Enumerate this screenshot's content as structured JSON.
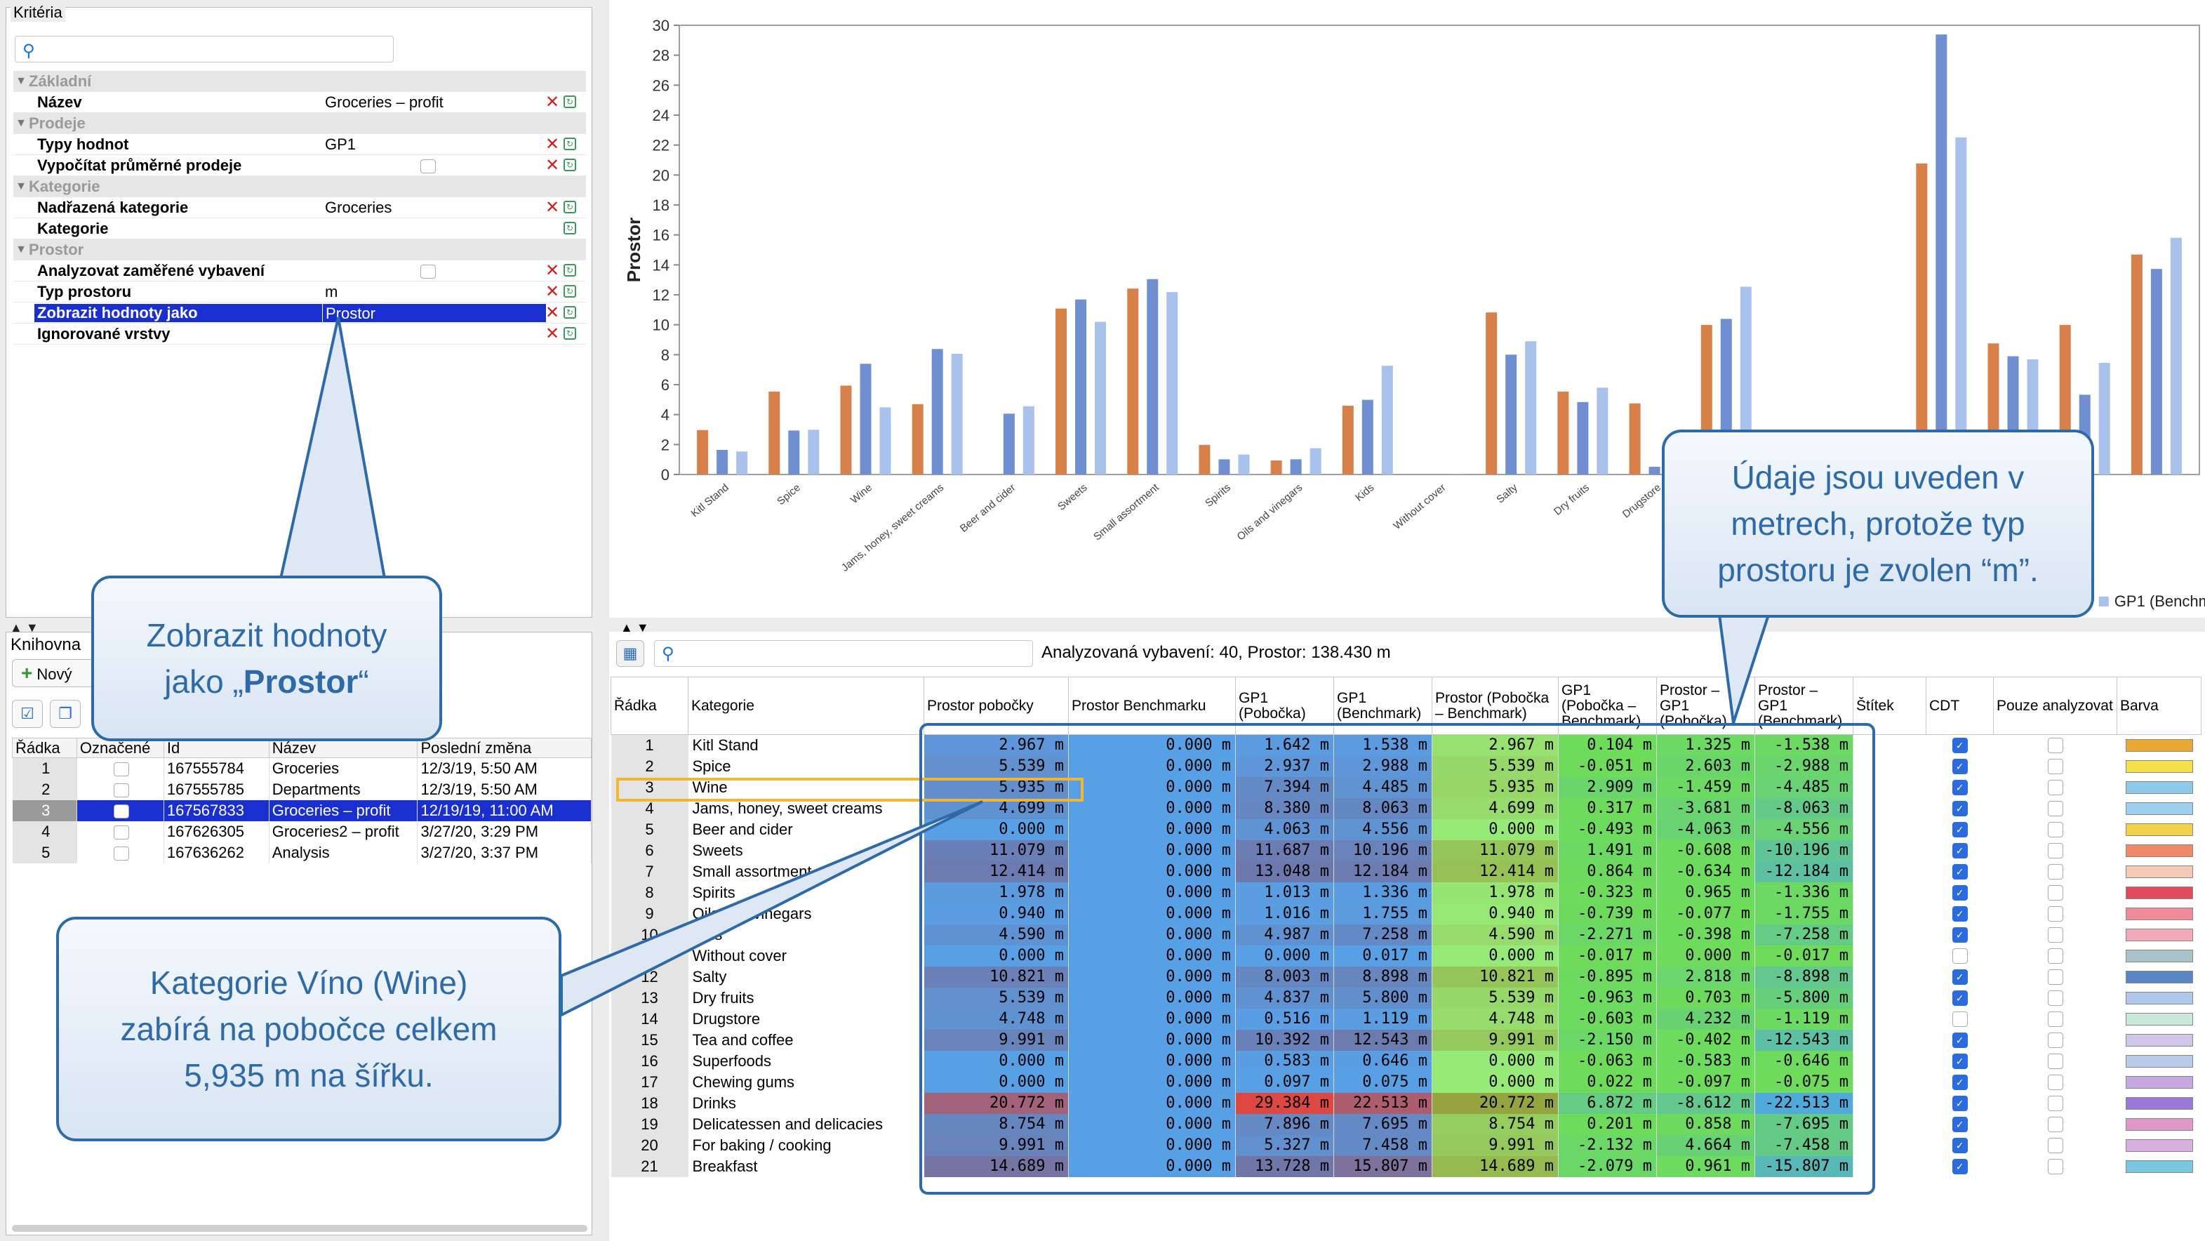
{
  "criteria": {
    "title": "Kritéria",
    "groups": [
      {
        "label": "Základní",
        "rows": [
          {
            "label": "Název",
            "value": "Groceries – profit",
            "check": false
          }
        ]
      },
      {
        "label": "Prodeje",
        "rows": [
          {
            "label": "Typy hodnot",
            "value": "GP1",
            "check": false
          },
          {
            "label": "Vypočítat průměrné prodeje",
            "value": "",
            "check": true
          }
        ]
      },
      {
        "label": "Kategorie",
        "rows": [
          {
            "label": "Nadřazená kategorie",
            "value": "Groceries",
            "check": false
          },
          {
            "label": "Kategorie",
            "value": "",
            "check": false
          }
        ]
      },
      {
        "label": "Prostor",
        "rows": [
          {
            "label": "Analyzovat zaměřené vybavení",
            "value": "",
            "check": true
          },
          {
            "label": "Typ prostoru",
            "value": "m",
            "check": false
          },
          {
            "label": "Zobrazit hodnoty jako",
            "value": "Prostor",
            "check": false,
            "selected": true
          },
          {
            "label": "Ignorované vrstvy",
            "value": "",
            "check": false
          }
        ]
      }
    ]
  },
  "library": {
    "title": "Knihovna",
    "new_label": "Nový",
    "columns": [
      "Řádka",
      "Označené",
      "Id",
      "Název",
      "Poslední změna"
    ],
    "rows": [
      {
        "n": "1",
        "id": "167555784",
        "name": "Groceries",
        "changed": "12/3/19, 5:50 AM"
      },
      {
        "n": "2",
        "id": "167555785",
        "name": "Departments",
        "changed": "12/3/19, 5:50 AM"
      },
      {
        "n": "3",
        "id": "167567833",
        "name": "Groceries – profit",
        "changed": "12/19/19, 11:00 AM",
        "selected": true
      },
      {
        "n": "4",
        "id": "167626305",
        "name": "Groceries2 – profit",
        "changed": "3/27/20, 3:29 PM"
      },
      {
        "n": "5",
        "id": "167636262",
        "name": "Analysis",
        "changed": "3/27/20, 3:37 PM"
      }
    ]
  },
  "chart_data": {
    "type": "bar",
    "ylabel": "Prostor",
    "ylim": [
      0,
      30
    ],
    "yticks": [
      0,
      2,
      4,
      6,
      8,
      10,
      12,
      14,
      16,
      18,
      20,
      22,
      24,
      26,
      28,
      30
    ],
    "grid": false,
    "legend": "bottom",
    "categories": [
      "Kitl Stand",
      "Spice",
      "Wine",
      "Jams, honey, sweet creams",
      "Beer and cider",
      "Sweets",
      "Small assortment",
      "Spirits",
      "Oils and vinegars",
      "Kids",
      "Without cover",
      "Salty",
      "Dry fruits",
      "Drugstore",
      "Tea and coffee",
      "Superfoods",
      "Chewing gums",
      "Drinks",
      "Delicatessen and delicacies",
      "For baking / cooking",
      "Breakfast"
    ],
    "visible_tick_count": 15,
    "series": [
      {
        "name": "Prostor pobočky",
        "color": "#d8804a",
        "values": [
          2.967,
          5.539,
          5.935,
          4.699,
          0.0,
          11.079,
          12.414,
          1.978,
          0.94,
          4.59,
          0.0,
          10.821,
          5.539,
          4.748,
          9.991,
          0.0,
          0.0,
          20.772,
          8.754,
          9.991,
          14.689
        ]
      },
      {
        "name": "GP1 (Pobočka)",
        "color": "#6f8fd0",
        "values": [
          1.642,
          2.937,
          7.394,
          8.38,
          4.063,
          11.687,
          13.048,
          1.013,
          1.016,
          4.987,
          0.0,
          8.003,
          4.837,
          0.516,
          10.392,
          0.583,
          0.097,
          29.384,
          7.896,
          5.327,
          13.728
        ]
      },
      {
        "name": "GP1 (Benchmark)",
        "color": "#a9c2ec",
        "values": [
          1.538,
          2.988,
          4.485,
          8.063,
          4.556,
          10.196,
          12.184,
          1.336,
          1.755,
          7.258,
          0.017,
          8.898,
          5.8,
          1.119,
          12.543,
          0.646,
          0.075,
          22.513,
          7.695,
          7.458,
          15.807
        ]
      }
    ]
  },
  "data_table": {
    "summary": "Analyzovaná vybavení: 40, Prostor: 138.430 m",
    "columns": [
      "Řádka",
      "Kategorie",
      "Prostor pobočky",
      "Prostor Benchmarku",
      "GP1 (Pobočka)",
      "GP1 (Benchmark)",
      "Prostor (Pobočka – Benchmark)",
      "GP1 (Pobočka – Benchmark)",
      "Prostor – GP1 (Pobočka)",
      "Prostor – GP1 (Benchmark)",
      "Štítek",
      "CDT",
      "Pouze analyzovat",
      "Barva"
    ],
    "rows": [
      {
        "n": "1",
        "cat": "Kitl Stand",
        "v": [
          "2.967 m",
          "0.000 m",
          "1.642 m",
          "1.538 m",
          "2.967 m",
          "0.104 m",
          "1.325 m",
          "-1.538 m"
        ],
        "cdt": true,
        "color": "#e8a838"
      },
      {
        "n": "2",
        "cat": "Spice",
        "v": [
          "5.539 m",
          "0.000 m",
          "2.937 m",
          "2.988 m",
          "5.539 m",
          "-0.051 m",
          "2.603 m",
          "-2.988 m"
        ],
        "cdt": true,
        "color": "#f5e04a"
      },
      {
        "n": "3",
        "cat": "Wine",
        "v": [
          "5.935 m",
          "0.000 m",
          "7.394 m",
          "4.485 m",
          "5.935 m",
          "2.909 m",
          "-1.459 m",
          "-4.485 m"
        ],
        "cdt": true,
        "color": "#8ec9e6"
      },
      {
        "n": "4",
        "cat": "Jams, honey, sweet creams",
        "v": [
          "4.699 m",
          "0.000 m",
          "8.380 m",
          "8.063 m",
          "4.699 m",
          "0.317 m",
          "-3.681 m",
          "-8.063 m"
        ],
        "cdt": true,
        "color": "#9ed0ee"
      },
      {
        "n": "5",
        "cat": "Beer and cider",
        "v": [
          "0.000 m",
          "0.000 m",
          "4.063 m",
          "4.556 m",
          "0.000 m",
          "-0.493 m",
          "-4.063 m",
          "-4.556 m"
        ],
        "cdt": true,
        "color": "#f2d24a"
      },
      {
        "n": "6",
        "cat": "Sweets",
        "v": [
          "11.079 m",
          "0.000 m",
          "11.687 m",
          "10.196 m",
          "11.079 m",
          "1.491 m",
          "-0.608 m",
          "-10.196 m"
        ],
        "cdt": true,
        "color": "#ee8a6a"
      },
      {
        "n": "7",
        "cat": "Small assortment",
        "v": [
          "12.414 m",
          "0.000 m",
          "13.048 m",
          "12.184 m",
          "12.414 m",
          "0.864 m",
          "-0.634 m",
          "-12.184 m"
        ],
        "cdt": true,
        "color": "#f6c9b4"
      },
      {
        "n": "8",
        "cat": "Spirits",
        "v": [
          "1.978 m",
          "0.000 m",
          "1.013 m",
          "1.336 m",
          "1.978 m",
          "-0.323 m",
          "0.965 m",
          "-1.336 m"
        ],
        "cdt": true,
        "color": "#e04a5a"
      },
      {
        "n": "9",
        "cat": "Oils and vinegars",
        "v": [
          "0.940 m",
          "0.000 m",
          "1.016 m",
          "1.755 m",
          "0.940 m",
          "-0.739 m",
          "-0.077 m",
          "-1.755 m"
        ],
        "cdt": true,
        "color": "#ee8a9a"
      },
      {
        "n": "10",
        "cat": "Kids",
        "v": [
          "4.590 m",
          "0.000 m",
          "4.987 m",
          "7.258 m",
          "4.590 m",
          "-2.271 m",
          "-0.398 m",
          "-7.258 m"
        ],
        "cdt": true,
        "color": "#f0aab8"
      },
      {
        "n": "11",
        "cat": "Without cover",
        "v": [
          "0.000 m",
          "0.000 m",
          "0.000 m",
          "0.017 m",
          "0.000 m",
          "-0.017 m",
          "0.000 m",
          "-0.017 m"
        ],
        "cdt": false,
        "color": "#a8c4c8"
      },
      {
        "n": "12",
        "cat": "Salty",
        "v": [
          "10.821 m",
          "0.000 m",
          "8.003 m",
          "8.898 m",
          "10.821 m",
          "-0.895 m",
          "2.818 m",
          "-8.898 m"
        ],
        "cdt": true,
        "color": "#5a86c8"
      },
      {
        "n": "13",
        "cat": "Dry fruits",
        "v": [
          "5.539 m",
          "0.000 m",
          "4.837 m",
          "5.800 m",
          "5.539 m",
          "-0.963 m",
          "0.703 m",
          "-5.800 m"
        ],
        "cdt": true,
        "color": "#b0c8ea"
      },
      {
        "n": "14",
        "cat": "Drugstore",
        "v": [
          "4.748 m",
          "0.000 m",
          "0.516 m",
          "1.119 m",
          "4.748 m",
          "-0.603 m",
          "4.232 m",
          "-1.119 m"
        ],
        "cdt": false,
        "color": "#c8e8d8"
      },
      {
        "n": "15",
        "cat": "Tea and coffee",
        "v": [
          "9.991 m",
          "0.000 m",
          "10.392 m",
          "12.543 m",
          "9.991 m",
          "-2.150 m",
          "-0.402 m",
          "-12.543 m"
        ],
        "cdt": true,
        "color": "#d0c8ea"
      },
      {
        "n": "16",
        "cat": "Superfoods",
        "v": [
          "0.000 m",
          "0.000 m",
          "0.583 m",
          "0.646 m",
          "0.000 m",
          "-0.063 m",
          "-0.583 m",
          "-0.646 m"
        ],
        "cdt": true,
        "color": "#b8ccea"
      },
      {
        "n": "17",
        "cat": "Chewing gums",
        "v": [
          "0.000 m",
          "0.000 m",
          "0.097 m",
          "0.075 m",
          "0.000 m",
          "0.022 m",
          "-0.097 m",
          "-0.075 m"
        ],
        "cdt": true,
        "color": "#c8a8e0"
      },
      {
        "n": "18",
        "cat": "Drinks",
        "v": [
          "20.772 m",
          "0.000 m",
          "29.384 m",
          "22.513 m",
          "20.772 m",
          "6.872 m",
          "-8.612 m",
          "-22.513 m"
        ],
        "cdt": true,
        "color": "#9a78d8"
      },
      {
        "n": "19",
        "cat": "Delicatessen and delicacies",
        "v": [
          "8.754 m",
          "0.000 m",
          "7.896 m",
          "7.695 m",
          "8.754 m",
          "0.201 m",
          "0.858 m",
          "-7.695 m"
        ],
        "cdt": true,
        "color": "#e098c8"
      },
      {
        "n": "20",
        "cat": "For baking / cooking",
        "v": [
          "9.991 m",
          "0.000 m",
          "5.327 m",
          "7.458 m",
          "9.991 m",
          "-2.132 m",
          "4.664 m",
          "-7.458 m"
        ],
        "cdt": true,
        "color": "#d8b0e0"
      },
      {
        "n": "21",
        "cat": "Breakfast",
        "v": [
          "14.689 m",
          "0.000 m",
          "13.728 m",
          "15.807 m",
          "14.689 m",
          "-2.079 m",
          "0.961 m",
          "-15.807 m"
        ],
        "cdt": true,
        "color": "#7ac8e0"
      }
    ]
  },
  "callouts": {
    "prostor_a": "Zobrazit hodnoty",
    "prostor_b": "jako „",
    "prostor_bold": "Prostor",
    "prostor_c": "“",
    "wine_1": "Kategorie Víno (Wine)",
    "wine_2": "zabírá na pobočce celkem",
    "wine_3": "5,935 m na šířku.",
    "meters_1": "Údaje jsou uveden v",
    "meters_2": "metrech, protože typ",
    "meters_3": "prostoru je zvolen “m”."
  }
}
